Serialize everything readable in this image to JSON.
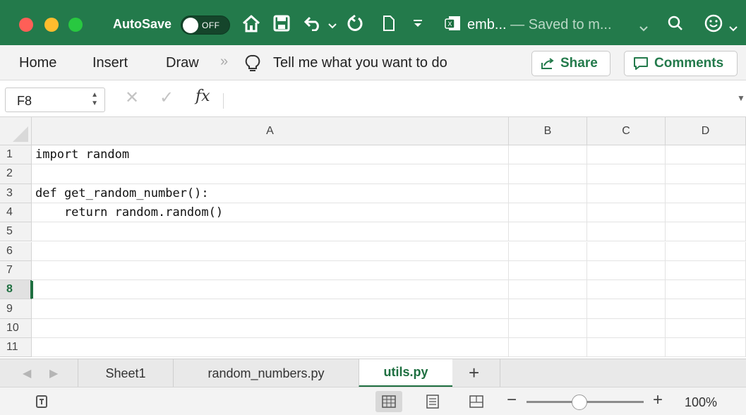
{
  "titlebar": {
    "autosave_label": "AutoSave",
    "autosave_state": "OFF",
    "doc_name": "emb...",
    "doc_status": " — Saved to m...",
    "colors": {
      "bar": "#237a4b"
    }
  },
  "icons": [
    "home-icon",
    "save-icon",
    "undo-icon",
    "redo-icon",
    "new-doc-icon",
    "customize-icon",
    "file-icon",
    "search-icon",
    "smiley-icon"
  ],
  "ribbon": {
    "tabs": [
      "Home",
      "Insert",
      "Draw"
    ],
    "more": "»",
    "tell_me": "Tell me what you want to do",
    "share_label": "Share",
    "comments_label": "Comments",
    "accent": "#237a4b"
  },
  "formula_bar": {
    "name_box": "F8",
    "fx": "fx",
    "formula": ""
  },
  "grid": {
    "columns": [
      "A",
      "B",
      "C",
      "D"
    ],
    "rows": [
      "1",
      "2",
      "3",
      "4",
      "5",
      "6",
      "7",
      "8",
      "9",
      "10",
      "11"
    ],
    "selected_row": "8",
    "cells_A": [
      "import random",
      "",
      "def get_random_number():",
      "    return random.random()",
      "",
      "",
      "",
      "",
      "",
      "",
      ""
    ]
  },
  "sheets": {
    "tabs": [
      "Sheet1",
      "random_numbers.py",
      "utils.py"
    ],
    "active": "utils.py",
    "add": "+"
  },
  "statusbar": {
    "zoom_minus": "−",
    "zoom_plus": "+",
    "zoom_level": "100%",
    "zoom_fraction": 0.45
  }
}
